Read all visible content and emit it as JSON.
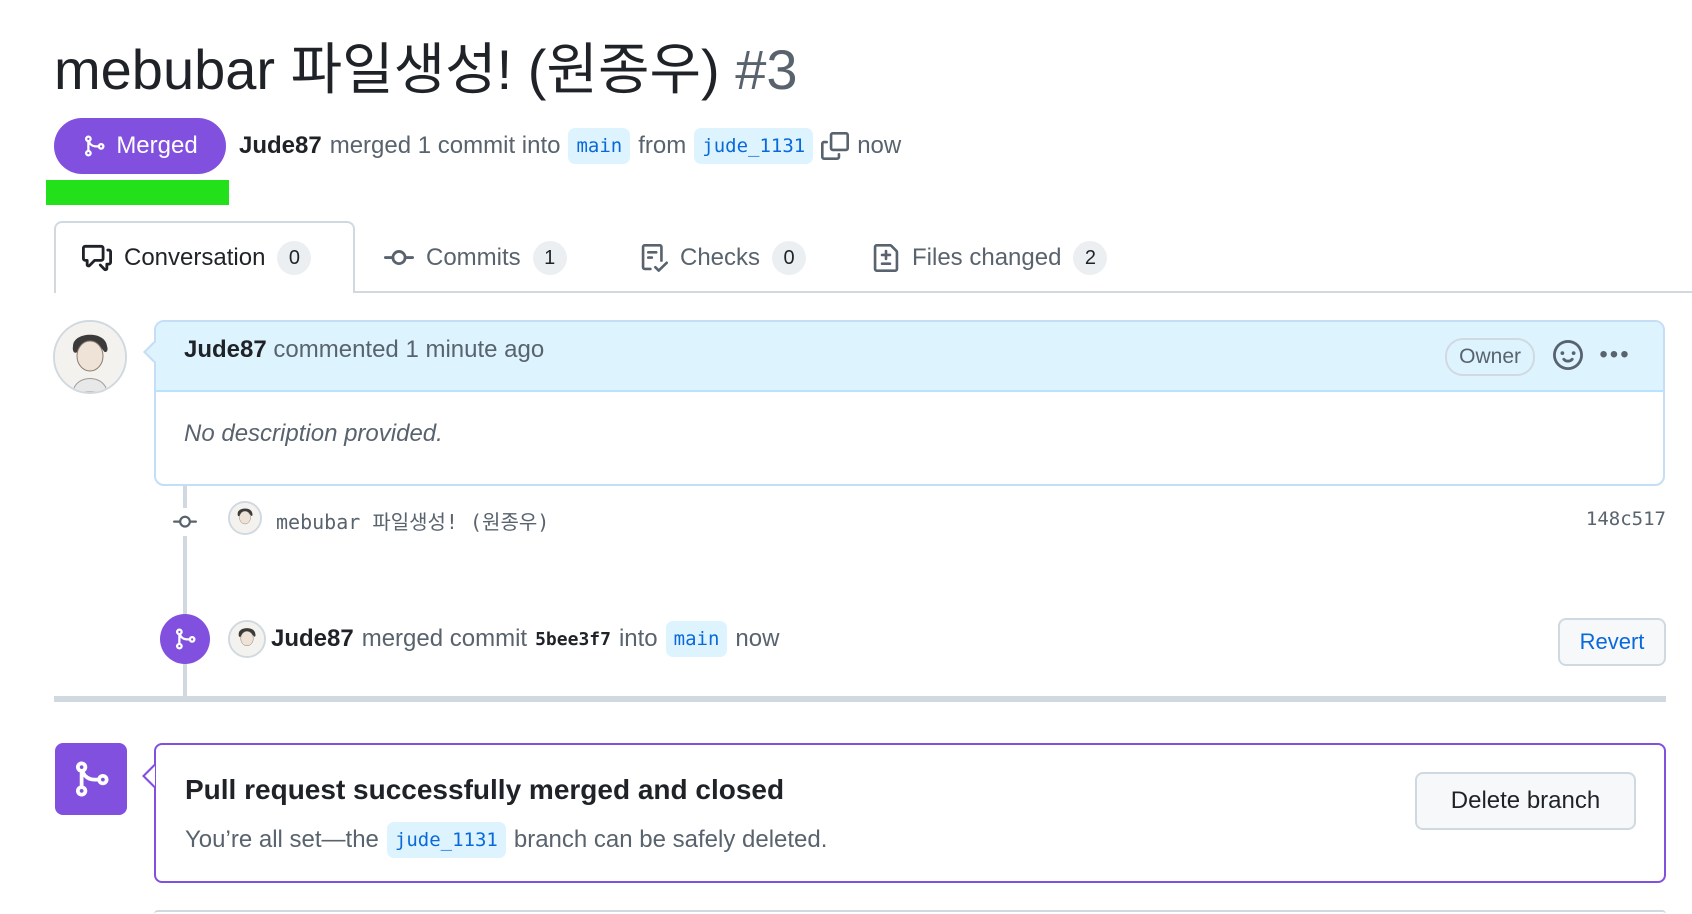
{
  "pr": {
    "title": "mebubar 파일생성! (원종우)",
    "number": "#3",
    "state": "Merged",
    "author": "Jude87",
    "merge_text": "merged 1 commit into",
    "base_branch": "main",
    "from_text": "from",
    "head_branch": "jude_1131",
    "time": "now"
  },
  "tabs": [
    {
      "label": "Conversation",
      "count": "0",
      "icon": "comment-discussion-icon"
    },
    {
      "label": "Commits",
      "count": "1",
      "icon": "git-commit-icon"
    },
    {
      "label": "Checks",
      "count": "0",
      "icon": "checklist-icon"
    },
    {
      "label": "Files changed",
      "count": "2",
      "icon": "file-diff-icon"
    }
  ],
  "comment": {
    "author": "Jude87",
    "action": "commented 1 minute ago",
    "role_badge": "Owner",
    "body": "No description provided."
  },
  "commit": {
    "message": "mebubar 파일생성! (원종우)",
    "sha": "148c517"
  },
  "merge_event": {
    "author": "Jude87",
    "text": "merged commit",
    "sha": "5bee3f7",
    "into_text": "into",
    "branch": "main",
    "time": "now",
    "revert_label": "Revert"
  },
  "merged_box": {
    "title": "Pull request successfully merged and closed",
    "desc_prefix": "You’re all set—the",
    "branch": "jude_1131",
    "desc_suffix": "branch can be safely deleted.",
    "delete_label": "Delete branch"
  },
  "colors": {
    "merged_purple": "#8250df",
    "highlight_green": "#22e11a",
    "link_blue": "#0969da"
  }
}
